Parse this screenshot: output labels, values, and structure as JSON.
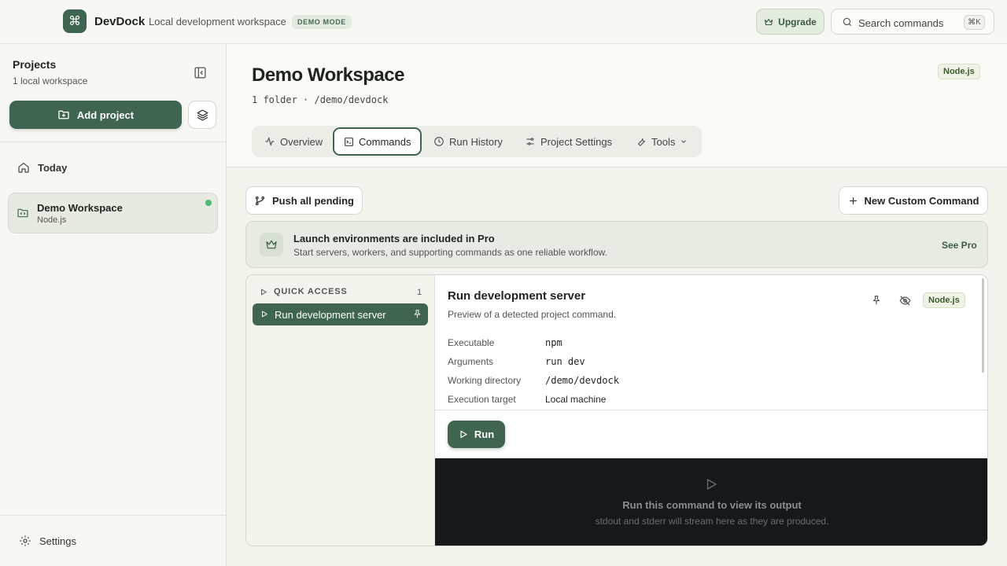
{
  "app": {
    "logo_glyph": "⌘",
    "name": "DevDock",
    "subtitle": "Local development workspace",
    "mode_badge": "DEMO MODE"
  },
  "topbar": {
    "upgrade_label": "Upgrade",
    "search_placeholder": "Search commands",
    "search_shortcut": "⌘K"
  },
  "sidebar": {
    "title": "Projects",
    "subtitle": "1 local workspace",
    "add_project_label": "Add project",
    "today_label": "Today",
    "projects": [
      {
        "name": "Demo Workspace",
        "runtime": "Node.js",
        "status": "active"
      }
    ],
    "settings_label": "Settings"
  },
  "workspace": {
    "title": "Demo Workspace",
    "path_line": "1 folder · /demo/devdock",
    "runtime_badge": "Node.js",
    "tabs": [
      {
        "label": "Overview",
        "icon": "activity-icon"
      },
      {
        "label": "Commands",
        "icon": "terminal-icon",
        "active": true
      },
      {
        "label": "Run History",
        "icon": "clock-icon"
      },
      {
        "label": "Project Settings",
        "icon": "sliders-icon"
      },
      {
        "label": "Tools",
        "icon": "wrench-icon"
      }
    ]
  },
  "actions": {
    "push_label": "Push all pending",
    "new_command_label": "New Custom Command"
  },
  "promo": {
    "title": "Launch environments are included in Pro",
    "description": "Start servers, workers, and supporting commands as one reliable workflow.",
    "link": "See Pro"
  },
  "quick_access": {
    "heading": "QUICK ACCESS",
    "count": "1",
    "commands": [
      {
        "label": "Run development server"
      }
    ]
  },
  "command_detail": {
    "title": "Run development server",
    "description": "Preview of a detected project command.",
    "badge": "Node.js",
    "fields": [
      {
        "label": "Executable",
        "value": "npm"
      },
      {
        "label": "Arguments",
        "value": "run dev"
      },
      {
        "label": "Working directory",
        "value": "/demo/devdock"
      },
      {
        "label": "Execution target",
        "value": "Local machine"
      }
    ],
    "run_label": "Run"
  },
  "terminal": {
    "title": "Run this command to view its output",
    "subtitle": "stdout and stderr will stream here as they are produced."
  },
  "colors": {
    "accent": "#3f6550",
    "status_active": "#4fba70",
    "terminal_bg": "#16181a"
  }
}
